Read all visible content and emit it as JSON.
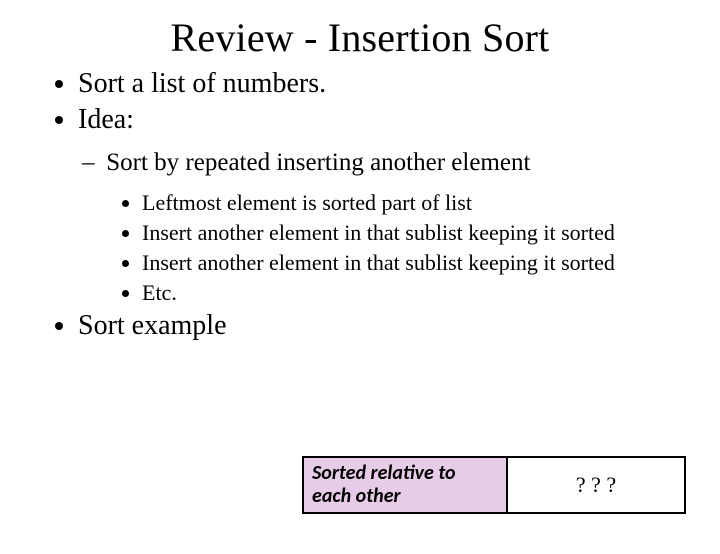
{
  "title": "Review - Insertion Sort",
  "bullets": {
    "b1": "Sort a list of numbers.",
    "b2": "Idea:",
    "sub": "Sort by repeated inserting another element",
    "s1": "Leftmost element is sorted part of list",
    "s2": "Insert another element in that sublist keeping it sorted",
    "s3": "Insert another element in that sublist keeping it sorted",
    "s4": "Etc.",
    "b3": "Sort example"
  },
  "diagram": {
    "left": "Sorted relative to each other",
    "right": "? ? ?"
  }
}
